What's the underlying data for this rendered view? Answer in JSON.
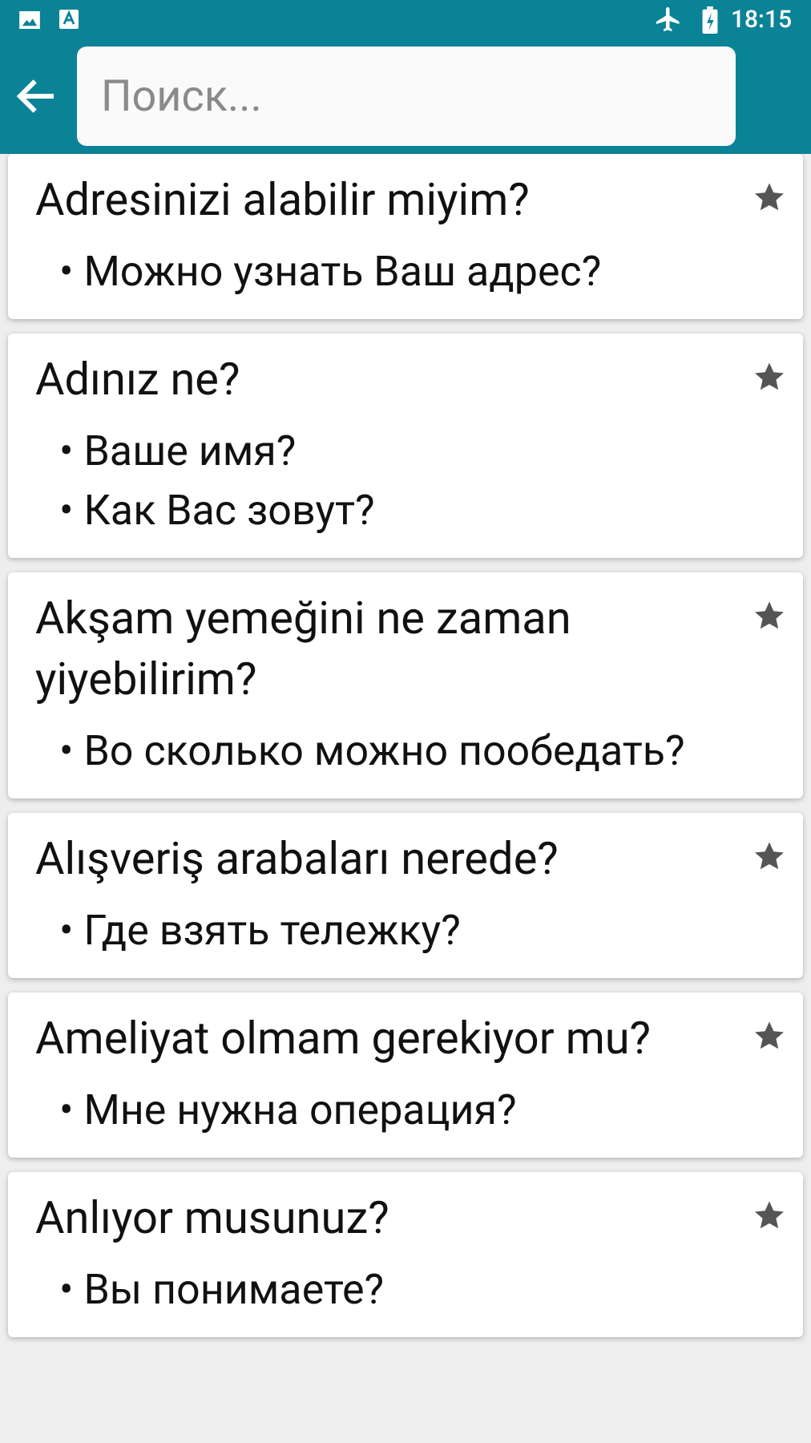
{
  "status_bar": {
    "time": "18:15"
  },
  "toolbar": {
    "search": {
      "placeholder": "Поиск..."
    }
  },
  "phrases": [
    {
      "text": "Adresinizi alabilir miyim?",
      "favorite": true,
      "translations": [
        "• Можно узнать Ваш адрес?"
      ]
    },
    {
      "text": "Adınız ne?",
      "favorite": true,
      "translations": [
        "• Ваше имя?",
        "• Как Вас зовут?"
      ]
    },
    {
      "text": "Akşam yemeğini ne zaman yiyebilirim?",
      "favorite": true,
      "translations": [
        "• Во сколько можно пообедать?"
      ]
    },
    {
      "text": "Alışveriş arabaları nerede?",
      "favorite": true,
      "translations": [
        "• Где взять тележку?"
      ]
    },
    {
      "text": "Ameliyat olmam gerekiyor mu?",
      "favorite": true,
      "translations": [
        "• Мне нужна операция?"
      ]
    },
    {
      "text": "Anlıyor musunuz?",
      "favorite": true,
      "translations": [
        "• Вы понимаете?"
      ]
    }
  ]
}
